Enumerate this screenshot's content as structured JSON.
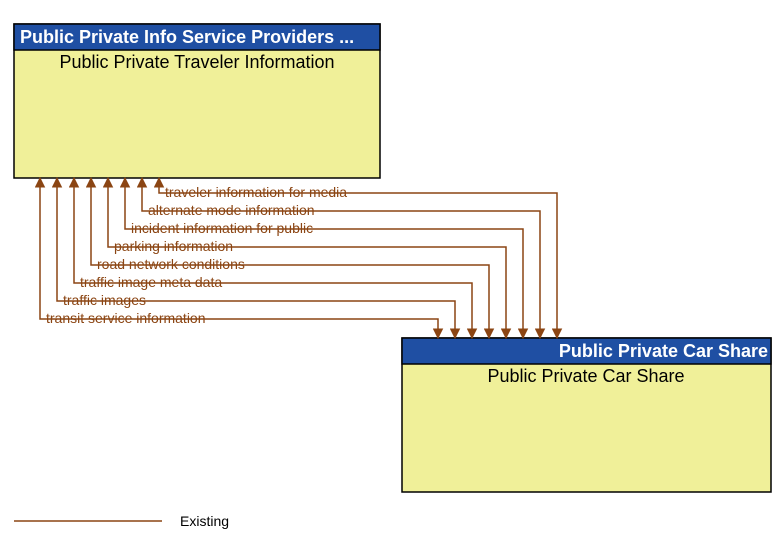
{
  "leftBox": {
    "header": "Public Private Info Service Providers ...",
    "body": "Public Private Traveler Information"
  },
  "rightBox": {
    "header": "Public Private Car Share",
    "body": "Public Private Car Share"
  },
  "flows": [
    "traveler information for media",
    "alternate mode information",
    "incident information for public",
    "parking information",
    "road network conditions",
    "traffic image meta data",
    "traffic images",
    "transit service information"
  ],
  "legend": {
    "label": "Existing"
  },
  "colors": {
    "boxFill": "#f0f099",
    "headerFill": "#1f4fa3",
    "flow": "#8b4513"
  }
}
